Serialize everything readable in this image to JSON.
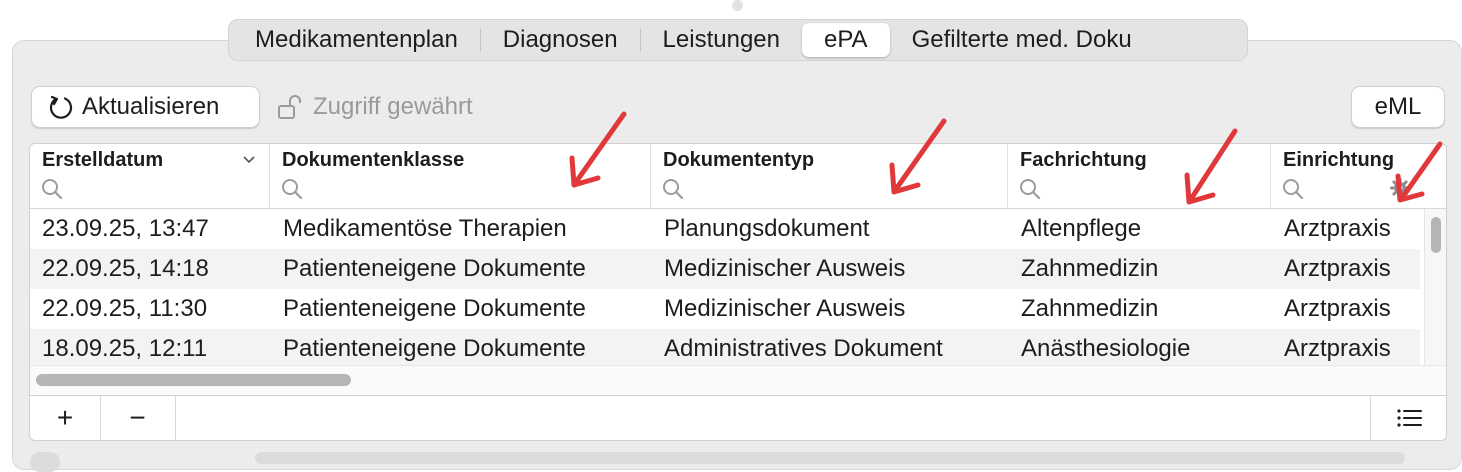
{
  "tabs": [
    {
      "label": "Medikamentenplan",
      "active": false
    },
    {
      "label": "Diagnosen",
      "active": false
    },
    {
      "label": "Leistungen",
      "active": false
    },
    {
      "label": "ePA",
      "active": true
    },
    {
      "label": "Gefilterte med. Doku",
      "active": false
    }
  ],
  "toolbar": {
    "refresh_label": "Aktualisieren",
    "access_label": "Zugriff gewährt",
    "eml_label": "eML"
  },
  "table": {
    "columns": [
      {
        "label": "Erstelldatum"
      },
      {
        "label": "Dokumentenklasse"
      },
      {
        "label": "Dokumententyp"
      },
      {
        "label": "Fachrichtung"
      },
      {
        "label": "Einrichtung"
      }
    ],
    "rows": [
      [
        "23.09.25, 13:47",
        "Medikamentöse Therapien",
        "Planungsdokument",
        "Altenpflege",
        "Arztpraxis"
      ],
      [
        "22.09.25, 14:18",
        "Patienteneigene Dokumente",
        "Medizinischer Ausweis",
        "Zahnmedizin",
        "Arztpraxis"
      ],
      [
        "22.09.25, 11:30",
        "Patienteneigene Dokumente",
        "Medizinischer Ausweis",
        "Zahnmedizin",
        "Arztpraxis"
      ],
      [
        "18.09.25, 12:11",
        "Patienteneigene Dokumente",
        "Administratives Dokument",
        "Anästhesiologie",
        "Arztpraxis"
      ]
    ]
  },
  "bottombar": {
    "add_symbol": "+",
    "remove_symbol": "−"
  },
  "annotation_color": "#e0383b"
}
